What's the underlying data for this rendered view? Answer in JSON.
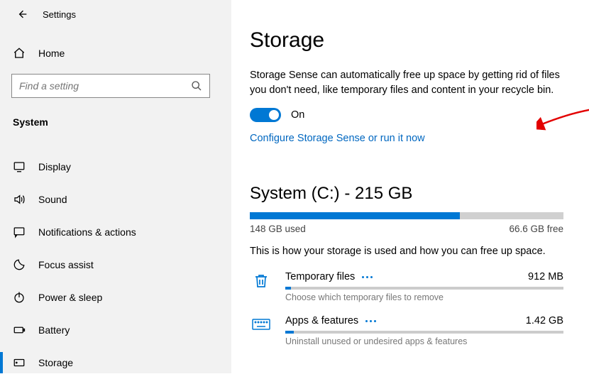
{
  "header": {
    "title": "Settings"
  },
  "home_label": "Home",
  "search": {
    "placeholder": "Find a setting"
  },
  "category": "System",
  "nav": [
    {
      "label": "Display"
    },
    {
      "label": "Sound"
    },
    {
      "label": "Notifications & actions"
    },
    {
      "label": "Focus assist"
    },
    {
      "label": "Power & sleep"
    },
    {
      "label": "Battery"
    },
    {
      "label": "Storage"
    }
  ],
  "page": {
    "title": "Storage",
    "desc": "Storage Sense can automatically free up space by getting rid of files you don't need, like temporary files and content in your recycle bin.",
    "toggle_label": "On",
    "link": "Configure Storage Sense or run it now",
    "drive_title": "System (C:) - 215 GB",
    "used_label": "148 GB used",
    "free_label": "66.6 GB free",
    "usage_desc": "This is how your storage is used and how you can free up space.",
    "items": [
      {
        "name": "Temporary files",
        "size": "912 MB",
        "sub": "Choose which temporary files to remove"
      },
      {
        "name": "Apps & features",
        "size": "1.42 GB",
        "sub": "Uninstall unused or undesired apps & features"
      }
    ]
  }
}
